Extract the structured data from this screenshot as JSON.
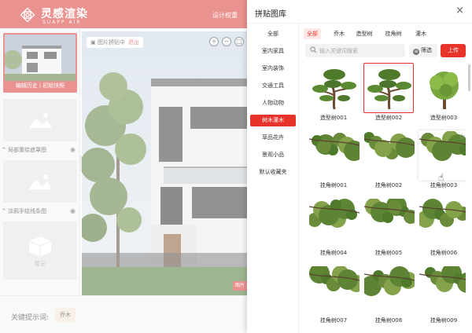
{
  "app": {
    "brand_cn": "灵感渲染",
    "brand_en": "SUAPP AIR",
    "top_link": "设计权重",
    "thumb_caption": [
      "编辑历史",
      "初始快照"
    ],
    "layers": [
      "局部重绘遮罩图",
      "涂鸦手绘线条图"
    ],
    "empty_text": "暂无",
    "canvas_tag": "图片拼贴中",
    "canvas_exit": "退出",
    "canvas_badge": "图片",
    "keyword_label": "关键提示词:",
    "keyword_tag": "乔木"
  },
  "modal": {
    "title": "拼贴图库",
    "categories": [
      {
        "label": "全部",
        "active": false
      },
      {
        "label": "室内家具",
        "active": false
      },
      {
        "label": "室内装饰",
        "active": false
      },
      {
        "label": "交通工具",
        "active": false
      },
      {
        "label": "人物动物",
        "active": false
      },
      {
        "label": "树木灌木",
        "active": true
      },
      {
        "label": "草品花卉",
        "active": false
      },
      {
        "label": "景观小品",
        "active": false
      },
      {
        "label": "默认收藏夹",
        "active": false
      }
    ],
    "filters": [
      {
        "label": "全部",
        "active": true
      },
      {
        "label": "乔木",
        "active": false
      },
      {
        "label": "造型树",
        "active": false
      },
      {
        "label": "挂角树",
        "active": false
      },
      {
        "label": "灌木",
        "active": false
      }
    ],
    "search_placeholder": "输入关键词搜索",
    "filter_button": "筛选",
    "upload_button": "上传",
    "items": [
      {
        "name": "造型树001",
        "kind": "topiary"
      },
      {
        "name": "造型树002",
        "kind": "topiary",
        "state": "selected"
      },
      {
        "name": "造型树003",
        "kind": "round"
      },
      {
        "name": "挂角树001",
        "kind": "hang"
      },
      {
        "name": "挂角树002",
        "kind": "hang"
      },
      {
        "name": "挂角树003",
        "kind": "hang",
        "state": "hovered"
      },
      {
        "name": "挂角树004",
        "kind": "hang"
      },
      {
        "name": "挂角树005",
        "kind": "hang"
      },
      {
        "name": "挂角树006",
        "kind": "hang"
      },
      {
        "name": "挂角树007",
        "kind": "hang"
      },
      {
        "name": "挂角树008",
        "kind": "hang"
      },
      {
        "name": "挂角树009",
        "kind": "hang"
      }
    ]
  }
}
